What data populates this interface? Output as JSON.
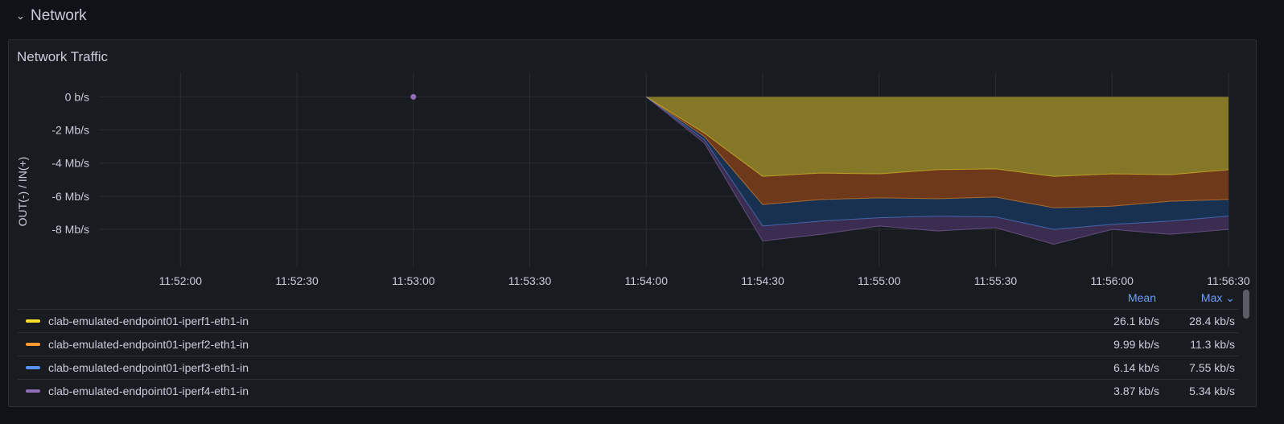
{
  "row": {
    "chevron": "⌄",
    "title": "Network"
  },
  "panel": {
    "title": "Network Traffic"
  },
  "legend_header": {
    "mean": "Mean",
    "max": "Max ⌄"
  },
  "chart_data": {
    "type": "area",
    "stacked": true,
    "ylabel": "OUT(-) / IN(+)",
    "yticks": [
      "0 b/s",
      "-2 Mb/s",
      "-4 Mb/s",
      "-6 Mb/s",
      "-8 Mb/s"
    ],
    "ytick_values": [
      0,
      -2,
      -4,
      -6,
      -8
    ],
    "ylim": [
      -9.6,
      0.6
    ],
    "y_unit": "Mb/s",
    "xticks": [
      "11:52:00",
      "11:52:30",
      "11:53:00",
      "11:53:30",
      "11:54:00",
      "11:54:30",
      "11:55:00",
      "11:55:30",
      "11:56:00",
      "11:56:30"
    ],
    "x_range": [
      "11:51:39",
      "11:56:30"
    ],
    "grid": true,
    "legend_placement": "bottom",
    "isolated_point": {
      "x": "11:53:00",
      "y": 0,
      "color": "#8f6db7"
    },
    "x": [
      "11:54:00",
      "11:54:15",
      "11:54:30",
      "11:54:45",
      "11:55:00",
      "11:55:15",
      "11:55:30",
      "11:55:45",
      "11:56:00",
      "11:56:15",
      "11:56:30"
    ],
    "series": [
      {
        "name": "clab-emulated-endpoint01-iperf1-eth1-in",
        "color": "#fade2a",
        "fill": "#8a7c28",
        "mean": "26.1 kb/s",
        "max": "28.4 kb/s",
        "values": [
          0,
          -2.2,
          -4.8,
          -4.6,
          -4.65,
          -4.4,
          -4.35,
          -4.8,
          -4.65,
          -4.7,
          -4.4
        ]
      },
      {
        "name": "clab-emulated-endpoint01-iperf2-eth1-in",
        "color": "#ff9830",
        "fill": "#733b1a",
        "mean": "9.99 kb/s",
        "max": "11.3 kb/s",
        "values": [
          0,
          -0.2,
          -1.7,
          -1.6,
          -1.45,
          -1.75,
          -1.7,
          -1.9,
          -1.95,
          -1.6,
          -1.8
        ]
      },
      {
        "name": "clab-emulated-endpoint01-iperf3-eth1-in",
        "color": "#5794f2",
        "fill": "#183354",
        "mean": "6.14 kb/s",
        "max": "7.55 kb/s",
        "values": [
          0,
          -0.2,
          -1.3,
          -1.3,
          -1.2,
          -1.05,
          -1.2,
          -1.3,
          -1.1,
          -1.2,
          -1.0
        ]
      },
      {
        "name": "clab-emulated-endpoint01-iperf4-eth1-in",
        "color": "#8f6db7",
        "fill": "#3d2e54",
        "mean": "3.87 kb/s",
        "max": "5.34 kb/s",
        "values": [
          0,
          -0.2,
          -0.9,
          -0.8,
          -0.5,
          -0.9,
          -0.65,
          -0.9,
          -0.3,
          -0.8,
          -0.8
        ]
      }
    ]
  }
}
